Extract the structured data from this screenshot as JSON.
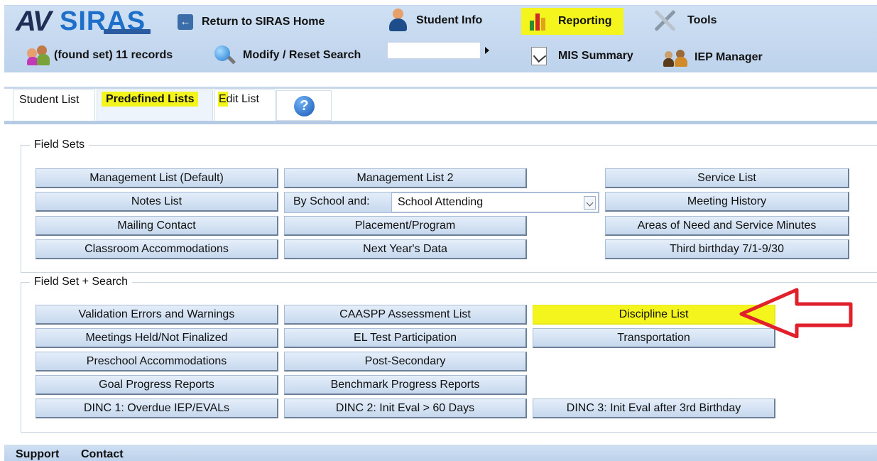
{
  "header": {
    "logo_av": "AV",
    "logo_siras": "SIRAS",
    "return_label": "Return to SIRAS Home",
    "student_info_label": "Student Info",
    "reporting_label": "Reporting",
    "tools_label": "Tools",
    "found_set_label": "(found set) 11 records",
    "modify_search_label": "Modify / Reset Search",
    "search_value": "",
    "mis_summary_label": "MIS Summary",
    "iep_manager_label": "IEP Manager"
  },
  "tabs": {
    "student_list": "Student List",
    "predefined_lists": "Predefined Lists",
    "edit_list": "Edit List",
    "help": "?"
  },
  "field_sets": {
    "legend": "Field Sets",
    "management_default": "Management List (Default)",
    "management_2": "Management List 2",
    "service_list": "Service List",
    "notes_list": "Notes List",
    "by_school_label": "By School and:",
    "by_school_selected": "School Attending",
    "meeting_history": "Meeting History",
    "mailing_contact": "Mailing Contact",
    "placement_program": "Placement/Program",
    "areas_of_need": "Areas of Need and Service Minutes",
    "classroom_accommodations": "Classroom Accommodations",
    "next_years_data": "Next Year's Data",
    "third_birthday": "Third birthday 7/1-9/30"
  },
  "field_set_search": {
    "legend": "Field Set + Search",
    "validation_errors": "Validation Errors and Warnings",
    "caaspp": "CAASPP Assessment List",
    "discipline_list": "Discipline List",
    "meetings_held": "Meetings Held/Not Finalized",
    "el_test": "EL Test Participation",
    "transportation": "Transportation",
    "preschool_accommodations": "Preschool Accommodations",
    "post_secondary": "Post-Secondary",
    "goal_progress": "Goal Progress Reports",
    "benchmark_progress": "Benchmark Progress Reports",
    "dinc1": "DINC 1: Overdue IEP/EVALs",
    "dinc2": "DINC 2: Init Eval > 60 Days",
    "dinc3": "DINC 3: Init Eval after 3rd Birthday"
  },
  "footer": {
    "support": "Support",
    "contact": "Contact"
  },
  "colors": {
    "highlight": "#f4f51c",
    "annotation_arrow": "#e0202a",
    "header_bg": "#c9dcf1",
    "button_bg": "#d3e2f3"
  }
}
